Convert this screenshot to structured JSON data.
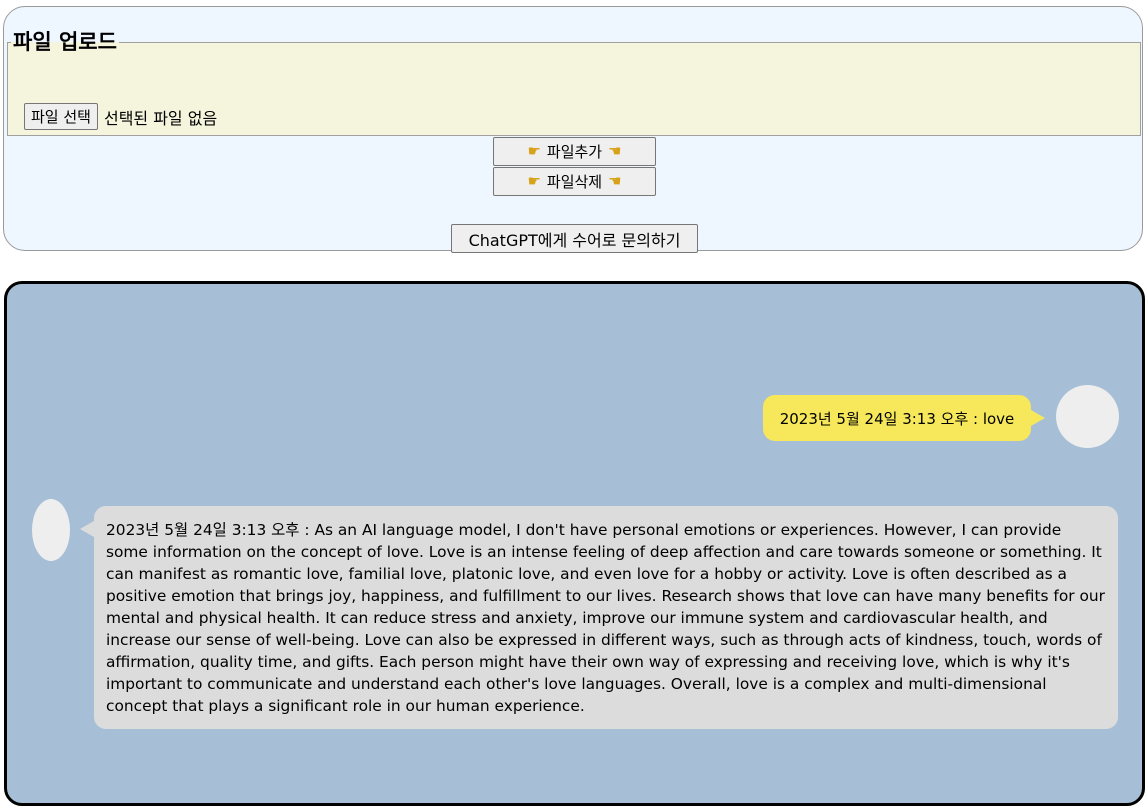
{
  "upload": {
    "legend": "파일 업로드",
    "choose_button_label": "파일 선택",
    "file_status": "선택된 파일 없음"
  },
  "actions": {
    "add_label": "파일추가",
    "delete_label": "파일삭제",
    "ask_label": "ChatGPT에게 수어로 문의하기"
  },
  "chat": {
    "messages": [
      {
        "role": "user",
        "text": "2023년 5월 24일 3:13 오후 : love"
      },
      {
        "role": "assistant",
        "text": "2023년 5월 24일 3:13 오후 : As an AI language model, I don't have personal emotions or experiences. However, I can provide some information on the concept of love. Love is an intense feeling of deep affection and care towards someone or something. It can manifest as romantic love, familial love, platonic love, and even love for a hobby or activity. Love is often described as a positive emotion that brings joy, happiness, and fulfillment to our lives. Research shows that love can have many benefits for our mental and physical health. It can reduce stress and anxiety, improve our immune system and cardiovascular health, and increase our sense of well-being. Love can also be expressed in different ways, such as through acts of kindness, touch, words of affirmation, quality time, and gifts. Each person might have their own way of expressing and receiving love, which is why it's important to communicate and understand each other's love languages. Overall, love is a complex and multi-dimensional concept that plays a significant role in our human experience."
      }
    ]
  },
  "icons": {
    "pointing_hand": "pointing-hand-icon"
  },
  "colors": {
    "upload_panel_bg": "#eef6ff",
    "fieldset_bg": "#f5f4dc",
    "chat_panel_bg": "#a7bfd6",
    "user_bubble": "#f6e85a",
    "assistant_bubble": "#dcdcdc",
    "avatar": "#eeeeee"
  }
}
